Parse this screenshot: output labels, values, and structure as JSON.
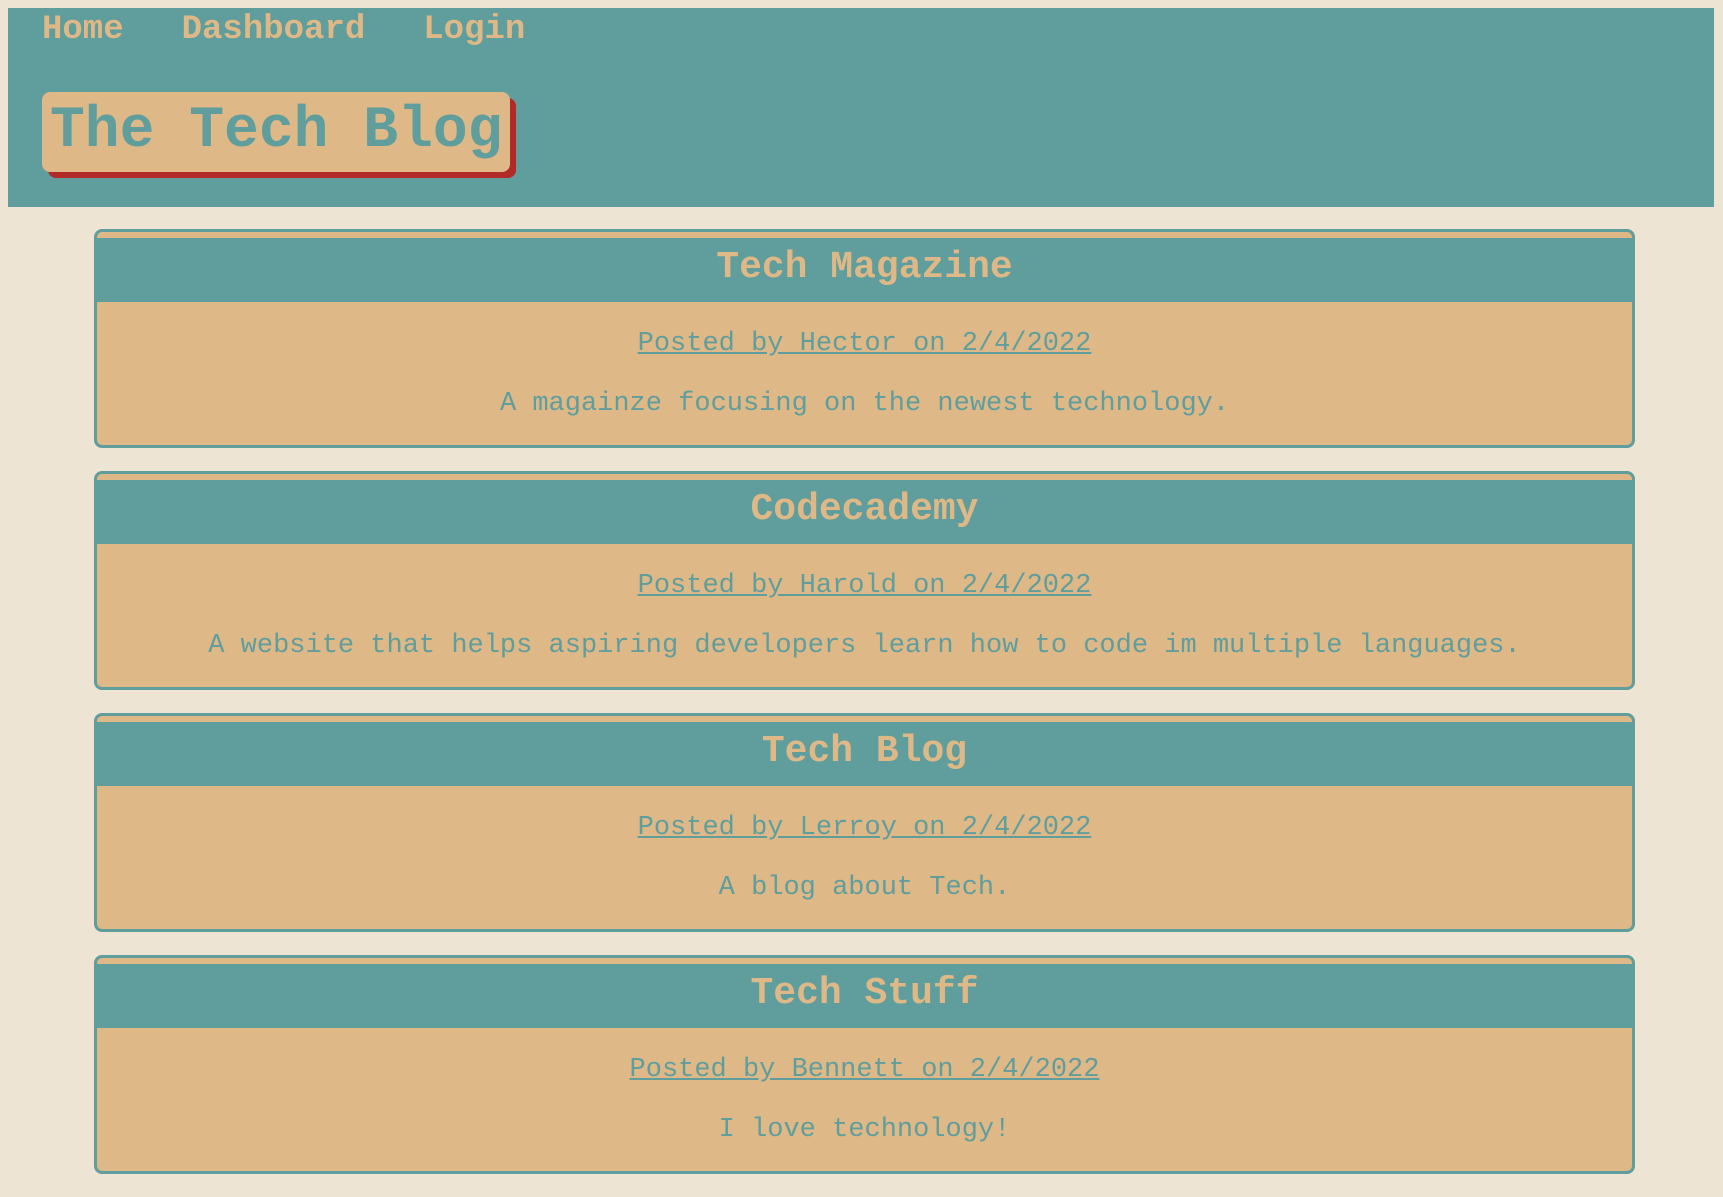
{
  "nav": {
    "home": "Home",
    "dashboard": "Dashboard",
    "login": "Login"
  },
  "site_title": "The Tech Blog",
  "colors": {
    "teal": "#5f9e9c",
    "tan": "#deb887",
    "background": "#ede4d4",
    "shadow_red": "#b22a28"
  },
  "posts": [
    {
      "title": "Tech Magazine",
      "meta": "Posted by Hector on 2/4/2022",
      "body": "A magainze focusing on the newest technology."
    },
    {
      "title": "Codecademy",
      "meta": "Posted by Harold on 2/4/2022",
      "body": "A website that helps aspiring developers learn how to code im multiple languages."
    },
    {
      "title": "Tech Blog",
      "meta": "Posted by Lerroy on 2/4/2022",
      "body": "A blog about Tech."
    },
    {
      "title": "Tech Stuff",
      "meta": "Posted by Bennett on 2/4/2022",
      "body": "I love technology!"
    }
  ]
}
